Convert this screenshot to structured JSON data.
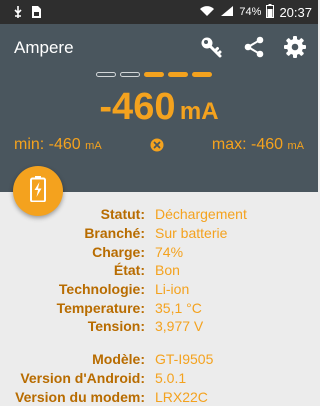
{
  "status_bar": {
    "battery_percent": "74%",
    "time": "20:37",
    "left_icons": [
      "usb-icon",
      "sd-card-icon"
    ],
    "right_icons": [
      "wifi-icon",
      "signal-icon",
      "battery-icon"
    ]
  },
  "app": {
    "title": "Ampere",
    "toolbar_icons": [
      "key-icon",
      "share-icon",
      "settings-icon"
    ]
  },
  "meter": {
    "current_value": "-460",
    "current_unit": "mA",
    "min_label": "min: -460",
    "min_unit": "mA",
    "max_label": "max: -460",
    "max_unit": "mA",
    "gauge_segments_on": 3,
    "gauge_segments_total": 5
  },
  "info_group1": [
    {
      "label": "Statut:",
      "value": "Déchargement"
    },
    {
      "label": "Branché:",
      "value": "Sur batterie"
    },
    {
      "label": "Charge:",
      "value": "74%"
    },
    {
      "label": "État:",
      "value": "Bon"
    },
    {
      "label": "Technologie:",
      "value": "Li-ion"
    },
    {
      "label": "Temperature:",
      "value": "35,1 °C"
    },
    {
      "label": "Tension:",
      "value": "3,977 V"
    }
  ],
  "info_group2": [
    {
      "label": "Modèle:",
      "value": "GT-I9505"
    },
    {
      "label": "Version d'Android:",
      "value": "5.0.1"
    },
    {
      "label": "Version du modem:",
      "value": "LRX22C"
    }
  ],
  "colors": {
    "accent": "#f4a21e",
    "label": "#b86c00",
    "toolbar": "#4a565e",
    "background": "#ececec"
  }
}
